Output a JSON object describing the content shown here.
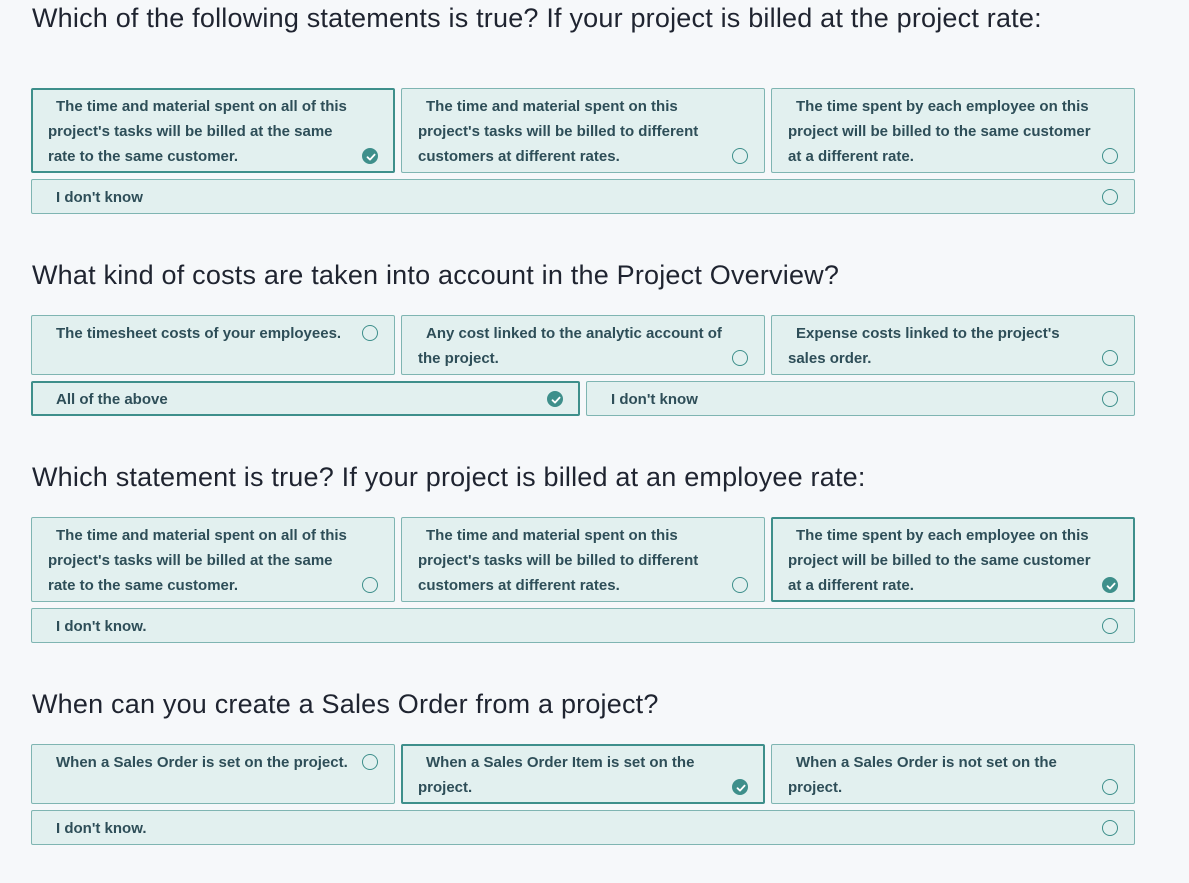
{
  "colors": {
    "accent": "#3e8f8b",
    "option_bg": "#e2f0ef",
    "option_border": "#7fb5b2",
    "text": "#2e4e58"
  },
  "questions": [
    {
      "title": "Which of the following statements is true? If your project is billed at the project rate:",
      "options": [
        {
          "label": "The time and material spent on all of this project's tasks will be billed at the same rate to the same customer.",
          "selected": true
        },
        {
          "label": "The time and material spent on this project's tasks will be billed to different customers at different rates.",
          "selected": false
        },
        {
          "label": "The time spent by each employee on this project will be billed to the same customer at a different rate.",
          "selected": false
        },
        {
          "label": "I don't know",
          "selected": false
        }
      ]
    },
    {
      "title": "What kind of costs are taken into account in the Project Overview?",
      "options": [
        {
          "label": "The timesheet costs of your employees.",
          "selected": false
        },
        {
          "label": "Any cost linked to the analytic account of the project.",
          "selected": false
        },
        {
          "label": "Expense costs linked to the project's sales order.",
          "selected": false
        },
        {
          "label": "All of the above",
          "selected": true
        },
        {
          "label": "I don't know",
          "selected": false
        }
      ]
    },
    {
      "title": "Which statement is true? If your project is billed at an employee rate:",
      "options": [
        {
          "label": "The time and material spent on all of this project's tasks will be billed at the same rate to the same customer.",
          "selected": false
        },
        {
          "label": "The time and material spent on this project's tasks will be billed to different customers at different rates.",
          "selected": false
        },
        {
          "label": "The time spent by each employee on this project will be billed to the same customer at a different rate.",
          "selected": true
        },
        {
          "label": "I don't know.",
          "selected": false
        }
      ]
    },
    {
      "title": "When can you create a Sales Order from a project?",
      "options": [
        {
          "label": "When a Sales Order is set on the project.",
          "selected": false
        },
        {
          "label": "When a Sales Order Item is set on the project.",
          "selected": true
        },
        {
          "label": "When a Sales Order is not set on the project.",
          "selected": false
        },
        {
          "label": "I don't know.",
          "selected": false
        }
      ]
    }
  ]
}
